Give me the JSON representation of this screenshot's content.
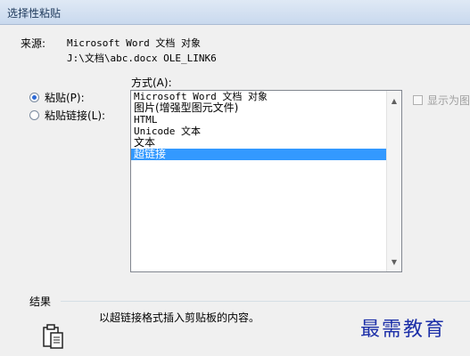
{
  "window": {
    "title": "选择性粘贴"
  },
  "source": {
    "label": "来源:",
    "app": "Microsoft Word 文档 对象",
    "path": "J:\\文档\\abc.docx OLE_LINK6"
  },
  "method": {
    "label": "方式(A):"
  },
  "options": [
    {
      "label": "粘贴(P):",
      "selected": true
    },
    {
      "label": "粘贴链接(L):",
      "selected": false
    }
  ],
  "format_list": [
    {
      "label": "Microsoft Word 文档 对象",
      "mono": true,
      "selected": false
    },
    {
      "label": "图片(增强型图元文件)",
      "mono": false,
      "selected": false
    },
    {
      "label": "HTML",
      "mono": true,
      "selected": false
    },
    {
      "label": "Unicode 文本",
      "mono": true,
      "selected": false
    },
    {
      "label": "文本",
      "mono": false,
      "selected": false
    },
    {
      "label": "超链接",
      "mono": false,
      "selected": true
    }
  ],
  "display_as_icon": {
    "label": "显示为图标",
    "checked": false
  },
  "result": {
    "label": "结果",
    "text": "以超链接格式插入剪贴板的内容。"
  },
  "watermark": {
    "text": "最需教育"
  },
  "colors": {
    "selection": "#3399ff",
    "watermark": "#1c2fa8"
  }
}
